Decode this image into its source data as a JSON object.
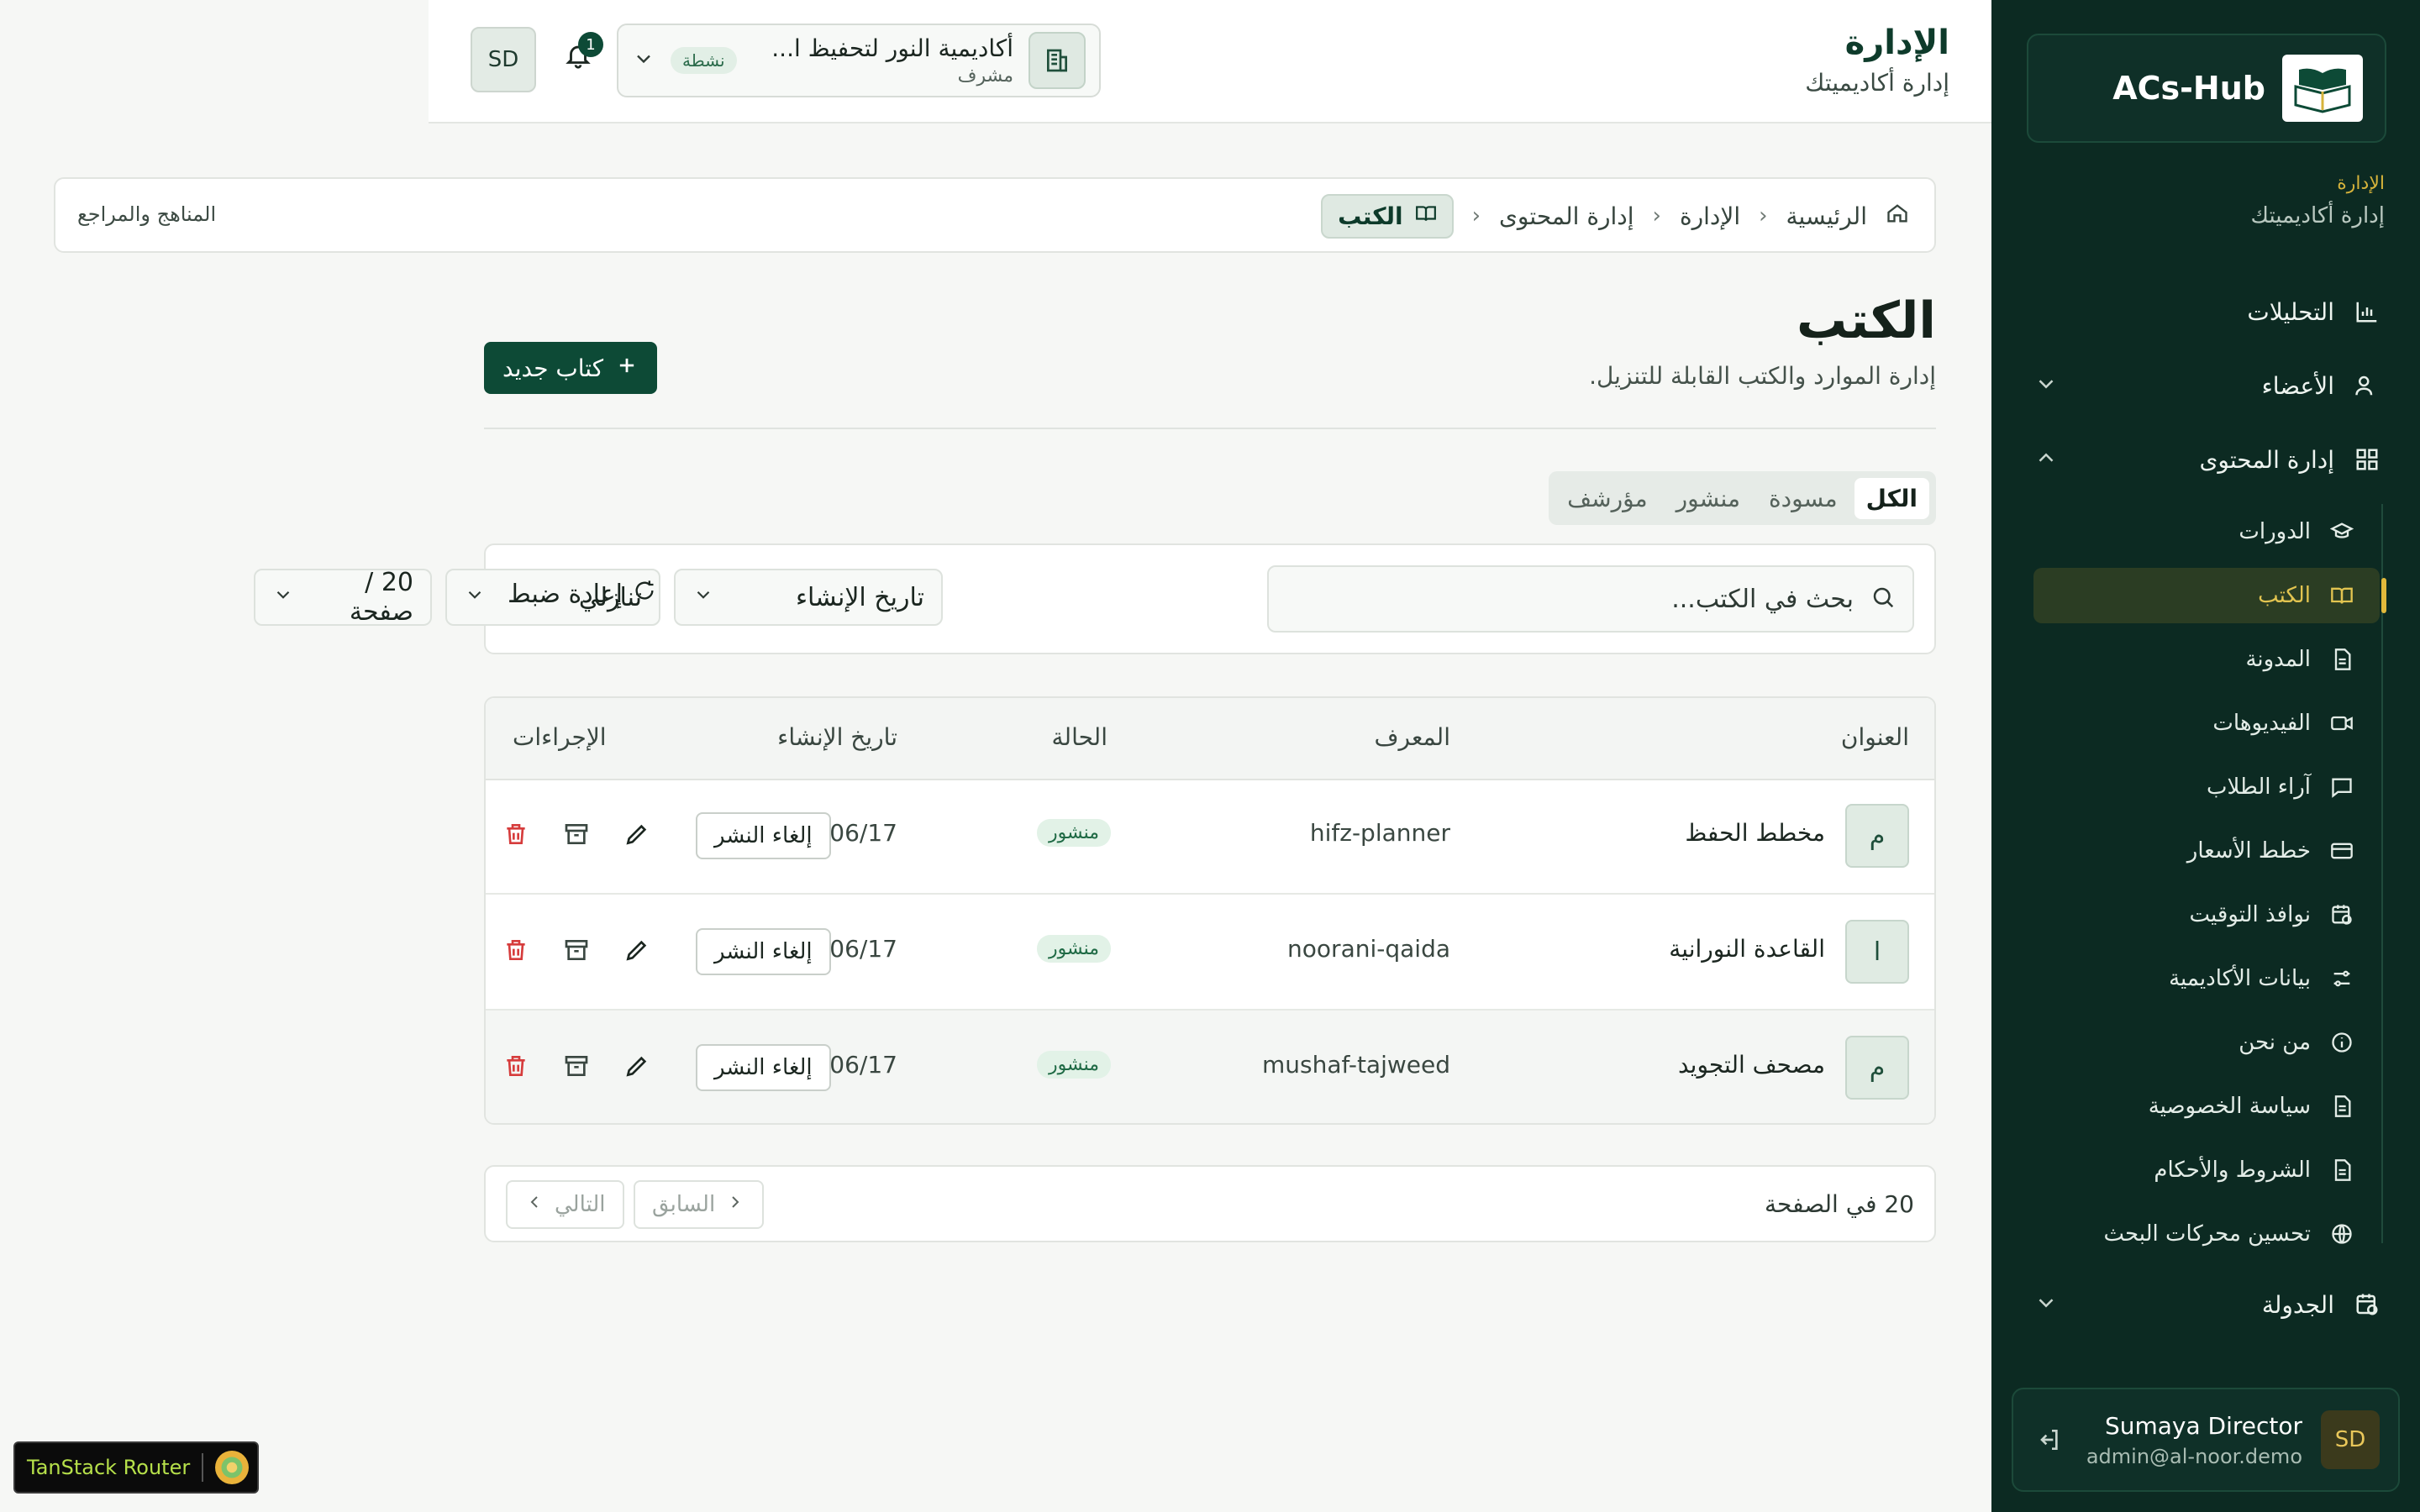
{
  "sidebar": {
    "brand": "ACs-Hub",
    "context_label": "الإدارة",
    "context_sub": "إدارة أكاديميتك",
    "nav": [
      {
        "label": "التحليلات",
        "icon": "chart-icon"
      },
      {
        "label": "الأعضاء",
        "icon": "users-icon"
      },
      {
        "label": "إدارة المحتوى",
        "icon": "grid-icon"
      }
    ],
    "subnav": [
      {
        "label": "الدورات",
        "icon": "graduation-cap-icon"
      },
      {
        "label": "الكتب",
        "icon": "book-open-icon"
      },
      {
        "label": "المدونة",
        "icon": "document-icon"
      },
      {
        "label": "الفيديوهات",
        "icon": "video-icon"
      },
      {
        "label": "آراء الطلاب",
        "icon": "message-icon"
      },
      {
        "label": "خطط الأسعار",
        "icon": "credit-card-icon"
      },
      {
        "label": "نوافذ التوقيت",
        "icon": "calendar-clock-icon"
      },
      {
        "label": "بيانات الأكاديمية",
        "icon": "sliders-icon"
      },
      {
        "label": "من نحن",
        "icon": "info-icon"
      },
      {
        "label": "سياسة الخصوصية",
        "icon": "document-icon"
      },
      {
        "label": "الشروط والأحكام",
        "icon": "document-icon"
      },
      {
        "label": "تحسين محركات البحث",
        "icon": "globe-icon"
      }
    ],
    "schedule": {
      "label": "الجدولة",
      "icon": "calendar-clock-icon"
    },
    "user": {
      "initials": "SD",
      "name": "Sumaya Director",
      "email": "admin@al-noor.demo"
    }
  },
  "header": {
    "title": "الإدارة",
    "subtitle": "إدارة أكاديميتك",
    "org": {
      "name": "أكاديمية النور لتحفيظ ا...",
      "role": "مشرف",
      "badge": "نشطة"
    },
    "notifications": "1",
    "avatar": "SD"
  },
  "breadcrumb": {
    "items": [
      "الرئيسية",
      "الإدارة",
      "إدارة المحتوى"
    ],
    "current": "الكتب",
    "side_text": "المناهج والمراجع"
  },
  "page": {
    "title": "الكتب",
    "description": "إدارة الموارد والكتب القابلة للتنزيل.",
    "new_button": "كتاب جديد"
  },
  "tabs": [
    "الكل",
    "مسودة",
    "منشور",
    "مؤرشف"
  ],
  "filters": {
    "search_placeholder": "بحث في الكتب...",
    "sort_field": "تاريخ الإنشاء",
    "sort_order": "تنازلي",
    "page_size": "20 / صفحة",
    "reset": "إعادة ضبط"
  },
  "table": {
    "columns": [
      "العنوان",
      "المعرف",
      "الحالة",
      "تاريخ الإنشاء",
      "الإجراءات"
    ],
    "rows": [
      {
        "initial": "م",
        "title": "مخطط الحفظ",
        "slug": "hifz-planner",
        "status": "منشور",
        "date": "2026/06/17",
        "action": "إلغاء النشر"
      },
      {
        "initial": "ا",
        "title": "القاعدة النورانية",
        "slug": "noorani-qaida",
        "status": "منشور",
        "date": "2026/06/17",
        "action": "إلغاء النشر"
      },
      {
        "initial": "م",
        "title": "مصحف التجويد",
        "slug": "mushaf-tajweed",
        "status": "منشور",
        "date": "2026/06/17",
        "action": "إلغاء النشر"
      }
    ]
  },
  "pagination": {
    "info": "20 في الصفحة",
    "prev": "السابق",
    "next": "التالي"
  },
  "devtools": {
    "label": "TanStack Router"
  },
  "colors": {
    "sidebar_bg": "#0c2a22",
    "accent": "#0d4a36",
    "gold": "#e2b93b",
    "danger": "#d63c3c"
  }
}
